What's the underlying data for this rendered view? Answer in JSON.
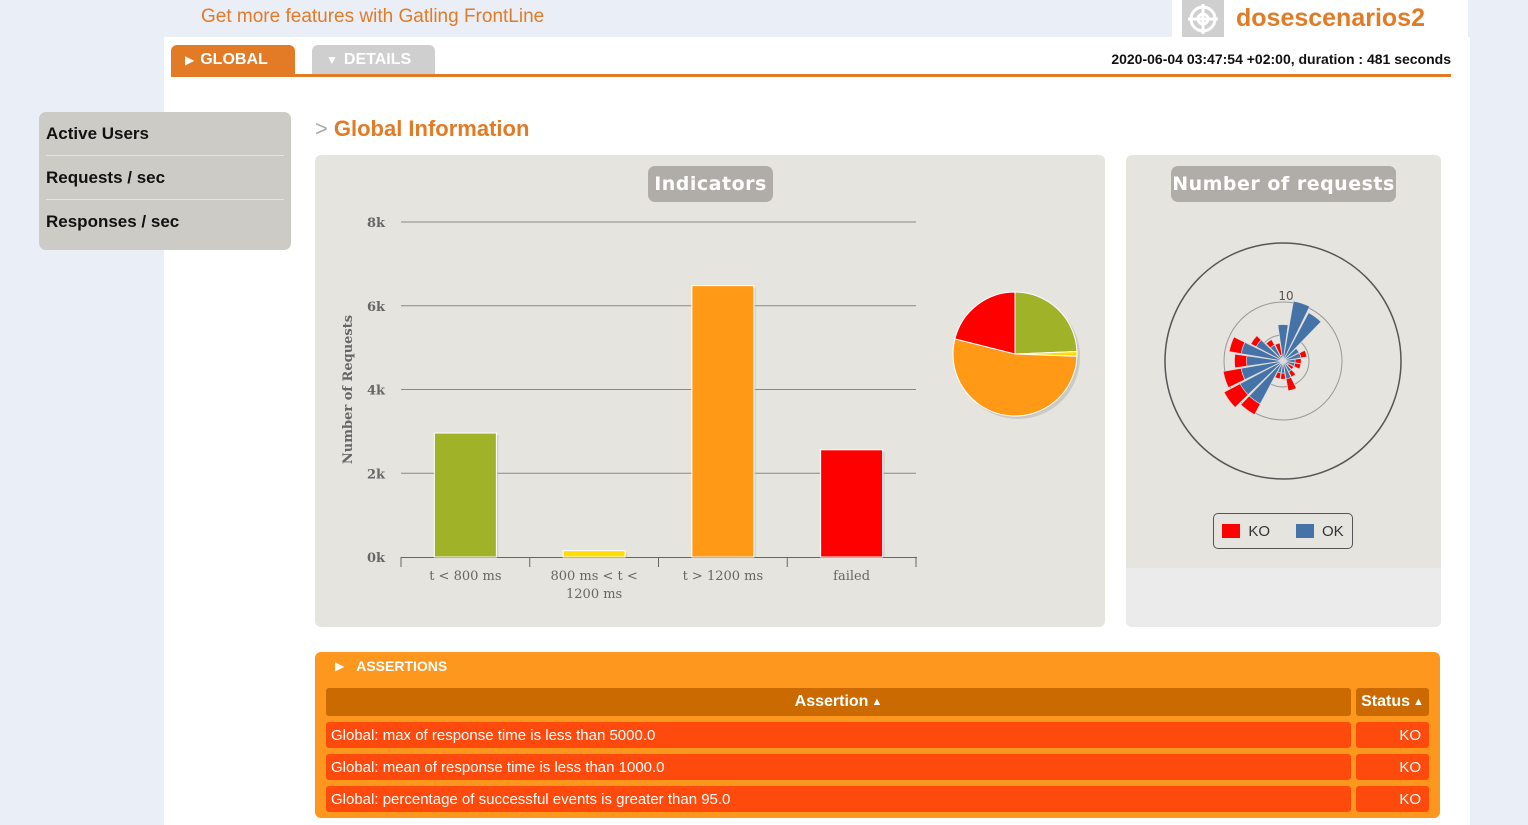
{
  "header": {
    "promo": "Get more features with Gatling FrontLine",
    "simulation": "dosescenarios2",
    "logo_icon": "crosshair-icon",
    "run_info": "2020-06-04 03:47:54 +02:00, duration : 481 seconds"
  },
  "tabs": [
    {
      "label": "GLOBAL",
      "icon": "triangle-right-icon"
    },
    {
      "label": "DETAILS",
      "icon": "triangle-down-icon"
    }
  ],
  "sidebar": {
    "items": [
      {
        "label": "Active Users"
      },
      {
        "label": "Requests / sec"
      },
      {
        "label": "Responses / sec"
      }
    ]
  },
  "section": {
    "title": "Global Information"
  },
  "panels": {
    "indicators_title": "Indicators",
    "requests_title": "Number of requests"
  },
  "colors": {
    "accent": "#e37a25",
    "green": "#a0b228",
    "yellow": "#ffdd00",
    "orange": "#ff9916",
    "red": "#ff0000",
    "ok_blue": "#4572a7"
  },
  "chart_data": [
    {
      "type": "bar",
      "title": "Indicators",
      "ylabel": "Number of Requests",
      "categories": [
        "t < 800 ms",
        "800 ms < t < 1200 ms",
        "t > 1200 ms",
        "failed"
      ],
      "values": [
        2960,
        150,
        6480,
        2560
      ],
      "colors": [
        "#a0b228",
        "#ffdd00",
        "#ff9916",
        "#ff0000"
      ],
      "ylim": [
        0,
        8000
      ],
      "yticks": [
        "0k",
        "2k",
        "4k",
        "6k",
        "8k"
      ],
      "grid": true
    },
    {
      "type": "pie",
      "labels": [
        "t < 800 ms",
        "800 ms < t < 1200 ms",
        "t > 1200 ms",
        "failed"
      ],
      "values": [
        2960,
        150,
        6480,
        2560
      ],
      "colors": [
        "#a0b228",
        "#ffdd00",
        "#ff9916",
        "#ff0000"
      ]
    },
    {
      "type": "polar-stacked-bar",
      "title": "Number of requests",
      "series": [
        {
          "name": "OK",
          "color": "#4572a7",
          "values": [
            6,
            10,
            9,
            3,
            3,
            2,
            2,
            1,
            2,
            3,
            2,
            2,
            8,
            8,
            7,
            6,
            7,
            5,
            3,
            1
          ]
        },
        {
          "name": "KO",
          "color": "#ff0000",
          "values": [
            0,
            0,
            0,
            0,
            1,
            1,
            1,
            1,
            1,
            2,
            1,
            1,
            2,
            3,
            3,
            2,
            2,
            1,
            1,
            2
          ]
        }
      ],
      "radial_ticks": [
        "10"
      ],
      "legend": "bottom-center"
    }
  ],
  "legend": {
    "ko": "KO",
    "ok": "OK"
  },
  "assertions": {
    "title": "ASSERTIONS",
    "header_assertion": "Assertion",
    "header_status": "Status",
    "sort_icon": "sort-icon",
    "rows": [
      {
        "text": "Global: max of response time is less than 5000.0",
        "status": "KO"
      },
      {
        "text": "Global: mean of response time is less than 1000.0",
        "status": "KO"
      },
      {
        "text": "Global: percentage of successful events is greater than 95.0",
        "status": "KO"
      }
    ]
  }
}
